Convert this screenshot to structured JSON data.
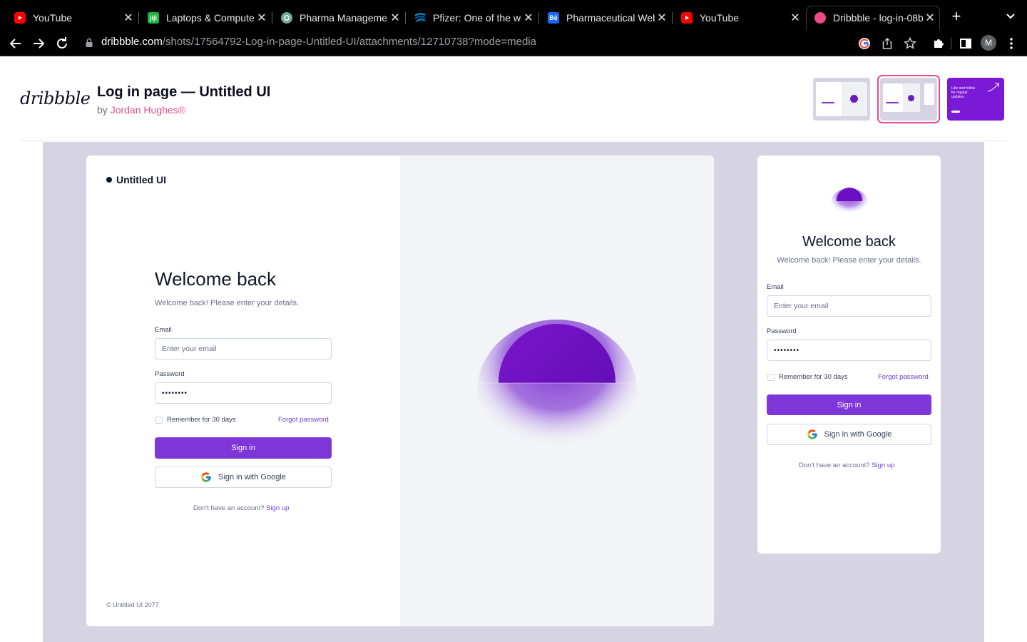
{
  "browser": {
    "tabs": [
      {
        "title": "YouTube",
        "icon": "youtube-icon",
        "color": "#ff0000"
      },
      {
        "title": "Laptops & Computers",
        "icon": "jiji-icon",
        "color": "#20b445"
      },
      {
        "title": "Pharma Management",
        "icon": "chatgpt-icon",
        "color": "#74aa9c"
      },
      {
        "title": "Pfizer: One of the wor",
        "icon": "pfizer-icon",
        "color": "#0093d0"
      },
      {
        "title": "Pharmaceutical Webs",
        "icon": "behance-icon",
        "color": "#1769ff"
      },
      {
        "title": "YouTube",
        "icon": "youtube-icon",
        "color": "#ff0000"
      },
      {
        "title": "Dribbble - log-in-08b",
        "icon": "dribbble-icon",
        "color": "#ea4c89"
      }
    ],
    "url_host": "dribbble.com",
    "url_path": "/shots/17564792-Log-in-page-Untitled-UI/attachments/12710738?mode=media",
    "profile_initial": "M"
  },
  "shot": {
    "logo": "dribbble",
    "title": "Log in page — Untitled UI",
    "by": "by",
    "author": "Jordan Hughes®",
    "thumb3_text": "Like and follow for regular updates"
  },
  "desktop": {
    "brand": "Untitled UI",
    "heading": "Welcome back",
    "subheading": "Welcome back! Please enter your details.",
    "email_label": "Email",
    "email_placeholder": "Enter your email",
    "password_label": "Password",
    "password_value": "••••••••",
    "remember": "Remember for 30 days",
    "forgot": "Forgot password",
    "sign_in": "Sign in",
    "google": "Sign in with Google",
    "no_account": "Don't have an account?",
    "sign_up": "Sign up",
    "copyright": "© Untitled UI 2077"
  },
  "mobile": {
    "heading": "Welcome back",
    "subheading": "Welcome back! Please enter your details.",
    "email_label": "Email",
    "email_placeholder": "Enter your email",
    "password_label": "Password",
    "password_value": "••••••••",
    "remember": "Remember for 30 days",
    "forgot": "Forgot password",
    "sign_in": "Sign in",
    "google": "Sign in with Google",
    "no_account": "Don't have an account?",
    "sign_up": "Sign up"
  },
  "colors": {
    "accent": "#7f36d9",
    "dribbble_pink": "#ea4c89",
    "canvas": "#d6d3e2",
    "orb": "#6a0fc2"
  }
}
